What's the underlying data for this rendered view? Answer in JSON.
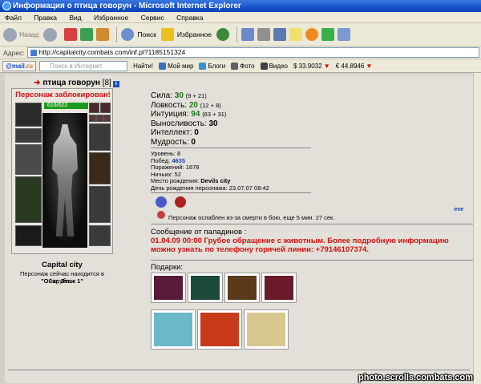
{
  "window": {
    "title": "Информация о птица говорун - Microsoft Internet Explorer"
  },
  "menu": [
    "Файл",
    "Правка",
    "Вид",
    "Избранное",
    "Сервис",
    "Справка"
  ],
  "toolbar": {
    "back": "Назад",
    "search": "Поиск",
    "favorites": "Избранное"
  },
  "address": {
    "label": "Адрес:",
    "url": "http://capitalcity.combats.com/inf.pl?1185151324"
  },
  "mailbar": {
    "logo_prefix": "@",
    "logo_mid": "mail",
    "logo_suffix": ".ru",
    "search_placeholder": "Поиск в Интернет",
    "find": "Найти!",
    "items": [
      "Мой мир",
      "Блоги",
      "Фото",
      "Видео"
    ],
    "usd": "$ 33.9032",
    "eur": "€ 44.8946"
  },
  "character": {
    "name": "птица говорун",
    "level": "[8]",
    "blocked": "Персонаж заблокирован!",
    "hp": "616/622",
    "city": "Capital city",
    "location_text": "Персонаж сейчас находится в клубе.",
    "room": "\"Общ. Этаж 1\""
  },
  "stats": [
    {
      "label": "Сила:",
      "value": "30",
      "extra": "(9 + 21)"
    },
    {
      "label": "Ловкость:",
      "value": "20",
      "extra": "(12 + 8)"
    },
    {
      "label": "Интуиция:",
      "value": "94",
      "extra": "(63 + 31)"
    },
    {
      "label": "Выносливость:",
      "value": "30",
      "extra": ""
    },
    {
      "label": "Интеллект:",
      "value": "0",
      "extra": ""
    },
    {
      "label": "Мудрость:",
      "value": "0",
      "extra": ""
    }
  ],
  "info": {
    "level": "Уровень: 8",
    "wins_label": "Побед:",
    "wins": "4635",
    "losses": "Поражений: 1678",
    "draws": "Ничьих: 52",
    "birthplace_label": "Место рождения:",
    "birthplace": "Devils city",
    "birthday": "День рождения персонажа: 23.07.07 08:42"
  },
  "effect_text": "Персонаж ослаблен из-за смерти в бою, еще 5 мин. 27 сек.",
  "paladin": {
    "header": "Сообщение от паладинов :",
    "text": "01.04.09 00:00 Грубое обращение с животным. Более подробную информацию можно узнать по телефону горячей линии: +79146107374."
  },
  "gifts": {
    "header": "Подарки:"
  },
  "side_text": "eve",
  "watermark": "photo.scrolls.combats.com",
  "colors": {
    "blocked": "#d01010",
    "green": "#1a7a1a",
    "hp": "#1c9a1c",
    "titlebar": "#1653c9"
  }
}
